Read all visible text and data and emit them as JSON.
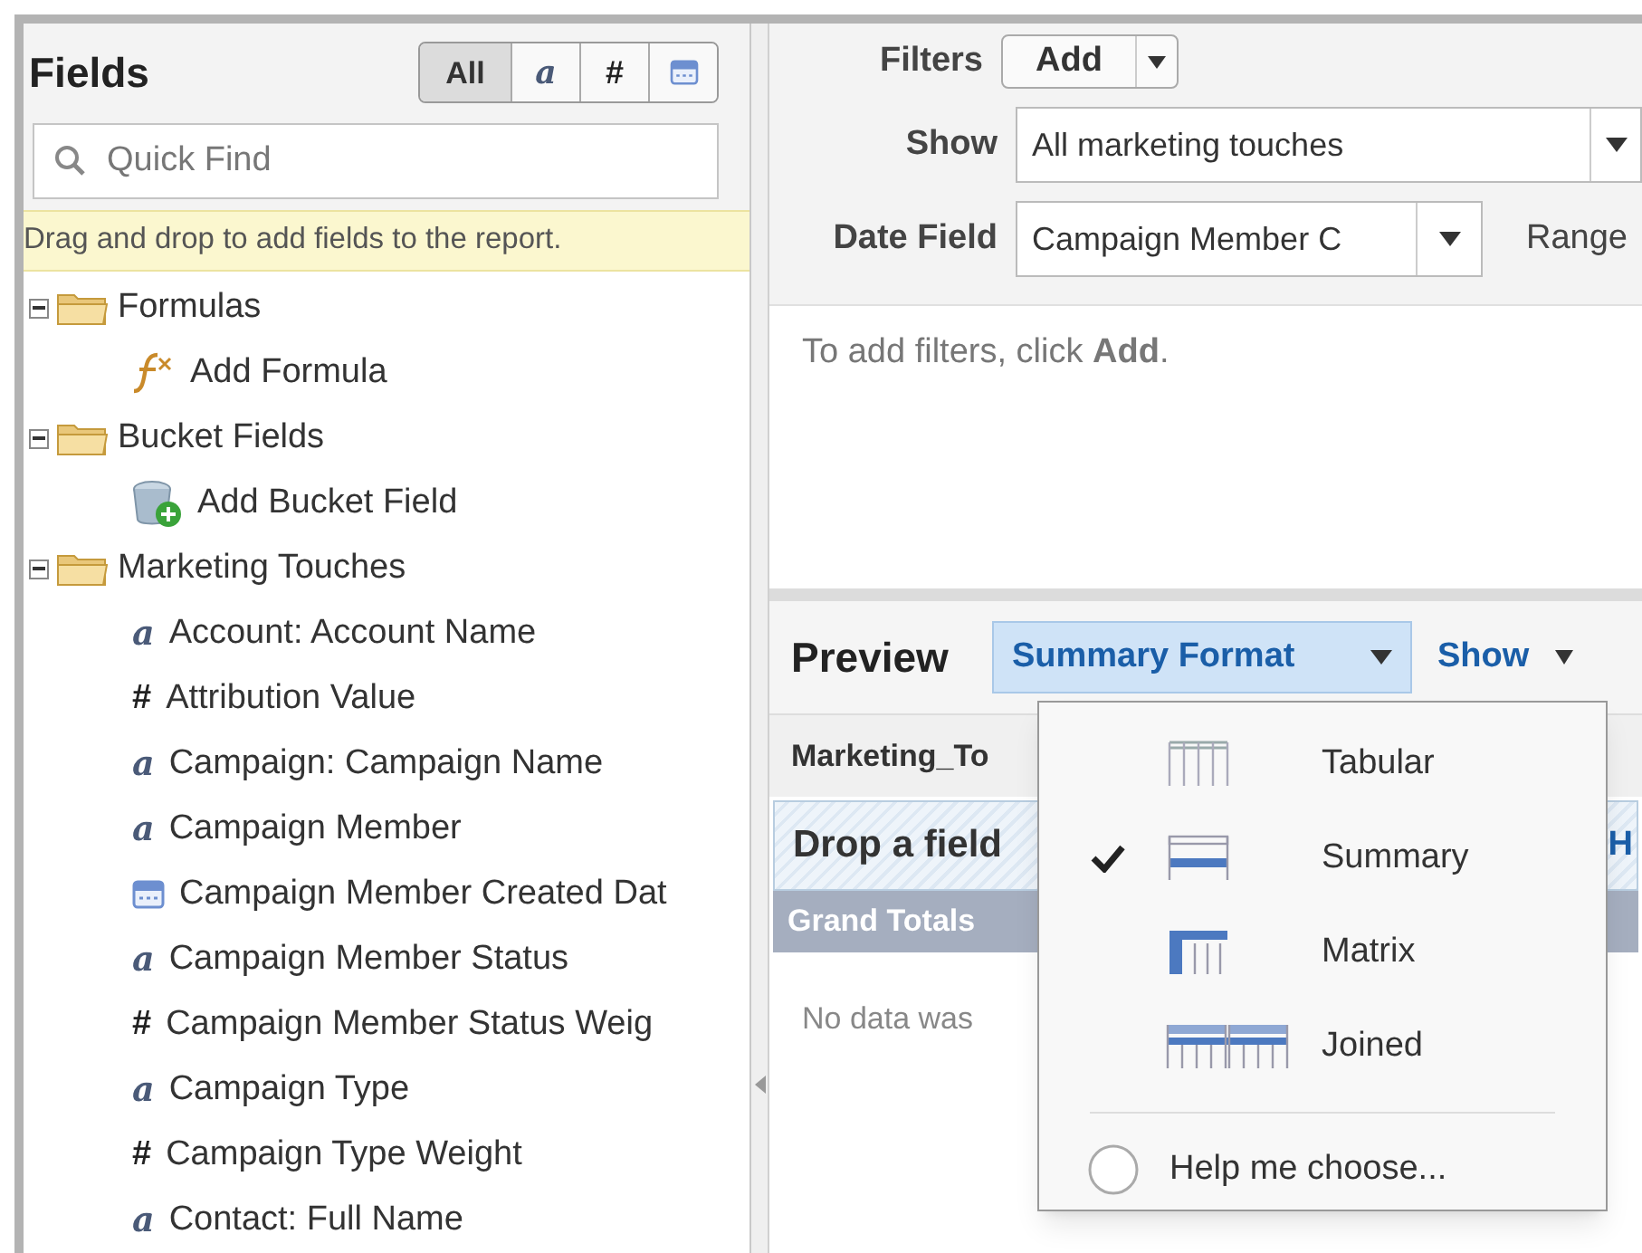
{
  "fields_panel": {
    "title": "Fields",
    "type_filters": [
      {
        "kind": "all",
        "label": "All",
        "selected": true
      },
      {
        "kind": "text",
        "icon": "a",
        "selected": false
      },
      {
        "kind": "number",
        "icon": "#",
        "selected": false
      },
      {
        "kind": "date",
        "selected": false
      }
    ],
    "search": {
      "placeholder": "Quick Find"
    },
    "hint": "Drag and drop to add fields to the report.",
    "tree": [
      {
        "label": "Formulas",
        "expanded": true,
        "children": [
          {
            "kind": "formula",
            "label": "Add Formula"
          }
        ]
      },
      {
        "label": "Bucket Fields",
        "expanded": true,
        "children": [
          {
            "kind": "bucket",
            "label": "Add Bucket Field"
          }
        ]
      },
      {
        "label": "Marketing Touches",
        "expanded": true,
        "children": [
          {
            "kind": "text",
            "icon": "a",
            "label": "Account: Account Name"
          },
          {
            "kind": "number",
            "icon": "#",
            "label": "Attribution Value"
          },
          {
            "kind": "text",
            "icon": "a",
            "label": "Campaign: Campaign Name"
          },
          {
            "kind": "text",
            "icon": "a",
            "label": "Campaign Member"
          },
          {
            "kind": "date",
            "label": "Campaign Member Created Dat"
          },
          {
            "kind": "text",
            "icon": "a",
            "label": "Campaign Member Status"
          },
          {
            "kind": "number",
            "icon": "#",
            "label": "Campaign Member Status Weig"
          },
          {
            "kind": "text",
            "icon": "a",
            "label": "Campaign Type"
          },
          {
            "kind": "number",
            "icon": "#",
            "label": "Campaign Type Weight"
          },
          {
            "kind": "text",
            "icon": "a",
            "label": "Contact: Full Name"
          }
        ]
      }
    ]
  },
  "filters": {
    "filters_label": "Filters",
    "add_button": "Add",
    "show_label": "Show",
    "show_value": "All marketing touches",
    "date_field_label": "Date Field",
    "date_field_value": "Campaign Member C",
    "range_label": "Range",
    "empty_message": "To add filters, click **Add**."
  },
  "preview": {
    "title": "Preview",
    "format_button": {
      "label": "Summary Format",
      "expanded": true
    },
    "show_button": "Show",
    "column_header": "Marketing_To",
    "drop_zone": "Drop a field",
    "drop_zone_right": "H",
    "grand_totals": "Grand Totals",
    "no_data": "No data was"
  },
  "format_menu": {
    "items": [
      {
        "kind": "tabular",
        "label": "Tabular",
        "selected": false
      },
      {
        "kind": "summary",
        "label": "Summary",
        "selected": true
      },
      {
        "kind": "matrix",
        "label": "Matrix",
        "selected": false
      },
      {
        "kind": "joined",
        "label": "Joined",
        "selected": false
      }
    ],
    "help": "Help me choose..."
  }
}
